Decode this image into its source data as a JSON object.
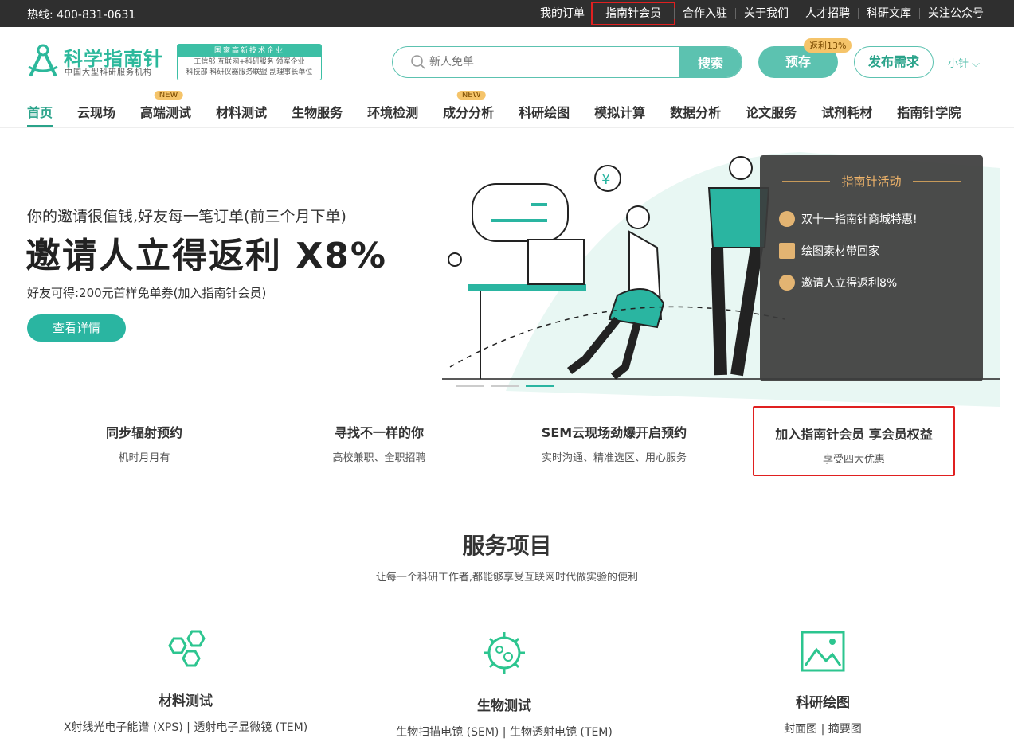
{
  "topbar": {
    "hotline": "热线: 400-831-0631",
    "links": [
      "我的订单",
      "指南针会员",
      "合作入驻",
      "关于我们",
      "人才招聘",
      "科研文库",
      "关注公众号"
    ]
  },
  "header": {
    "logo_name": "科学指南针",
    "logo_sub": "中国大型科研服务机构",
    "badge_line1": "国家高新技术企业",
    "badge_line2": "工信部 互联网+科研服务 领军企业",
    "badge_line3": "科技部 科研仪器服务联盟 副理事长单位",
    "search_placeholder": "新人免单",
    "search_button": "搜索",
    "prestore_button": "预存",
    "rebate_tag": "返利13%",
    "publish_button": "发布需求",
    "user_menu": "小针"
  },
  "nav": {
    "items": [
      "首页",
      "云现场",
      "高端测试",
      "材料测试",
      "生物服务",
      "环境检测",
      "成分分析",
      "科研绘图",
      "模拟计算",
      "数据分析",
      "论文服务",
      "试剂耗材",
      "指南针学院"
    ],
    "new_tag": "NEW"
  },
  "hero": {
    "subtitle": "你的邀请很值钱,好友每一笔订单(前三个月下单)",
    "headline": "邀请人立得返利 X8%",
    "friend_text": "好友可得:200元首样免单券(加入指南针会员)",
    "cta": "查看详情",
    "activity": {
      "title": "指南针活动",
      "items": [
        "双十一指南针商城特惠!",
        "绘图素材带回家",
        "邀请人立得返利8%"
      ]
    }
  },
  "features": [
    {
      "title": "同步辐射预约",
      "subtitle": "机时月月有"
    },
    {
      "title": "寻找不一样的你",
      "subtitle": "高校兼职、全职招聘"
    },
    {
      "title": "SEM云现场劲爆开启预约",
      "subtitle": "实时沟通、精准选区、用心服务"
    },
    {
      "title": "加入指南针会员 享会员权益",
      "subtitle": "享受四大优惠"
    }
  ],
  "services": {
    "title": "服务项目",
    "subtitle": "让每一个科研工作者,都能够享受互联网时代做实验的便利",
    "items": [
      {
        "title": "材料测试",
        "links": "X射线光电子能谱 (XPS) | 透射电子显微镜 (TEM)"
      },
      {
        "title": "生物测试",
        "links": "生物扫描电镜 (SEM) | 生物透射电镜 (TEM)"
      },
      {
        "title": "科研绘图",
        "links": "封面图 | 摘要图"
      }
    ]
  },
  "colors": {
    "brand": "#5cc2b0",
    "accent_dark": "#2aa38a",
    "highlight_box": "#e02020",
    "tag": "#f5c46a"
  }
}
